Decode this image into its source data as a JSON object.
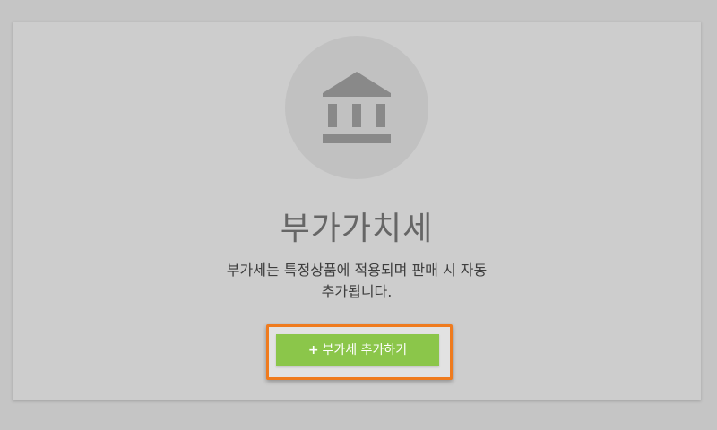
{
  "card": {
    "title": "부가가치세",
    "description_line1": "부가세는 특정상품에 적용되며 판매 시 자동",
    "description_line2": "추가됩니다.",
    "icon": "bank-icon"
  },
  "cta": {
    "plus_symbol": "+",
    "label": "부가세 추가하기"
  },
  "colors": {
    "accent_green": "#8bc64a",
    "highlight_orange": "#ef7b1e",
    "icon_gray": "#898989"
  }
}
